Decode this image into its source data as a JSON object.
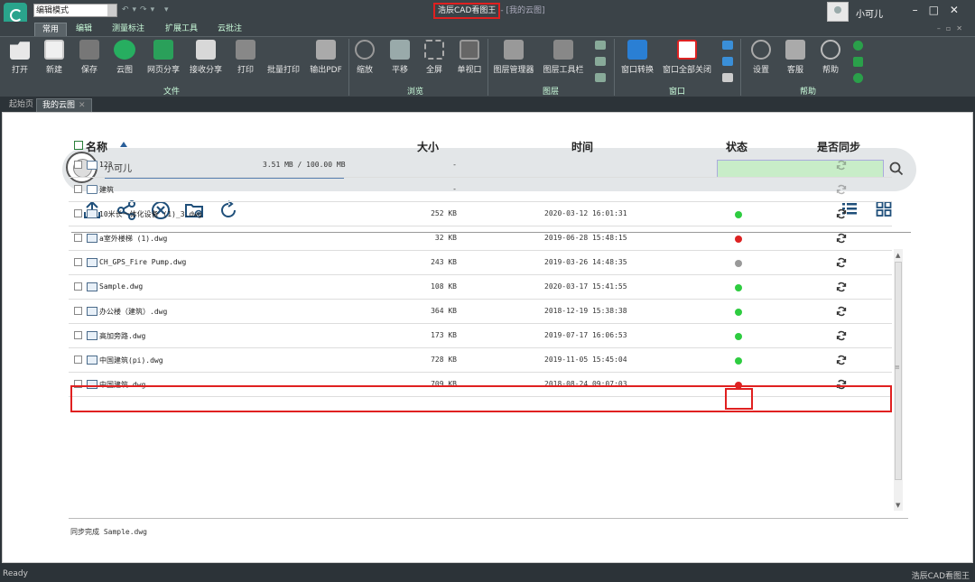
{
  "window": {
    "mode_select": "编辑模式",
    "app_title": "浩辰CAD看图王",
    "doc_title": "- [我的云图]",
    "user_name": "小可儿"
  },
  "ribbon_tabs": [
    "常用",
    "编辑",
    "测量标注",
    "扩展工具",
    "云批注"
  ],
  "ribbon": {
    "buttons": [
      {
        "label": "打开",
        "icon": "open-folder-icon"
      },
      {
        "label": "新建",
        "icon": "new-file-icon"
      },
      {
        "label": "保存",
        "icon": "save-icon"
      },
      {
        "label": "云图",
        "icon": "cloud-icon"
      },
      {
        "label": "网页分享",
        "icon": "share-icon"
      },
      {
        "label": "接收分享",
        "icon": "receive-share-icon"
      },
      {
        "label": "打印",
        "icon": "print-icon"
      },
      {
        "label": "批量打印",
        "icon": "batch-print-icon"
      },
      {
        "label": "输出PDF",
        "icon": "pdf-icon"
      },
      {
        "label": "缩放",
        "icon": "zoom-icon"
      },
      {
        "label": "平移",
        "icon": "pan-icon"
      },
      {
        "label": "全屏",
        "icon": "fullscreen-icon"
      },
      {
        "label": "单视口",
        "icon": "single-viewport-icon"
      },
      {
        "label": "图层管理器",
        "icon": "layer-manager-icon"
      },
      {
        "label": "图层工具栏",
        "icon": "layer-toolbar-icon"
      },
      {
        "label": "窗口转换",
        "icon": "window-switch-icon"
      },
      {
        "label": "窗口全部关闭",
        "icon": "close-all-windows-icon"
      },
      {
        "label": "设置",
        "icon": "settings-icon"
      },
      {
        "label": "客服",
        "icon": "customer-service-icon"
      },
      {
        "label": "帮助",
        "icon": "help-icon"
      }
    ],
    "groups": [
      "文件",
      "浏览",
      "图层",
      "窗口",
      "帮助"
    ]
  },
  "doc_tabs": [
    "起始页",
    "我的云图"
  ],
  "cloud": {
    "user_name": "小可儿",
    "quota_text": "3.51 MB / 100.00 MB",
    "quota_used_fraction": 0.0351,
    "search_placeholder": ""
  },
  "table": {
    "headers": {
      "name": "名称",
      "size": "大小",
      "time": "时间",
      "status": "状态",
      "sync": "是否同步"
    },
    "rows": [
      {
        "name": "123",
        "type": "folder",
        "size": "-",
        "time": "",
        "status": "",
        "synced": false
      },
      {
        "name": "建筑",
        "type": "folder",
        "size": "-",
        "time": "",
        "status": "",
        "synced": false
      },
      {
        "name": "10米长一体化设备 (1)_3.dwg",
        "type": "dwg",
        "size": "252 KB",
        "time": "2020-03-12 16:01:31",
        "status": "#2ecc40",
        "synced": true
      },
      {
        "name": "a室外楼梯 (1).dwg",
        "type": "dwg",
        "size": "32 KB",
        "time": "2019-06-28 15:48:15",
        "status": "#dd2222",
        "synced": true
      },
      {
        "name": "CH_GPS_Fire Pump.dwg",
        "type": "dwg",
        "size": "243 KB",
        "time": "2019-03-26 14:48:35",
        "status": "#999999",
        "synced": true
      },
      {
        "name": "Sample.dwg",
        "type": "dwg",
        "size": "108 KB",
        "time": "2020-03-17 15:41:55",
        "status": "#2ecc40",
        "synced": true
      },
      {
        "name": "办公楼（建筑）.dwg",
        "type": "dwg",
        "size": "364 KB",
        "time": "2018-12-19 15:38:38",
        "status": "#2ecc40",
        "synced": true
      },
      {
        "name": "高加旁路.dwg",
        "type": "dwg",
        "size": "173 KB",
        "time": "2019-07-17 16:06:53",
        "status": "#2ecc40",
        "synced": true
      },
      {
        "name": "中国建筑(pi).dwg",
        "type": "dwg",
        "size": "728 KB",
        "time": "2019-11-05 15:45:04",
        "status": "#2ecc40",
        "synced": true
      },
      {
        "name": "中国建筑.dwg",
        "type": "dwg",
        "size": "709 KB",
        "time": "2018-08-24 09:07:03",
        "status": "#dd2222",
        "synced": true
      }
    ]
  },
  "footer_message": "同步完成 Sample.dwg",
  "statusbar": {
    "left": "Ready",
    "right": "浩辰CAD看图王"
  }
}
